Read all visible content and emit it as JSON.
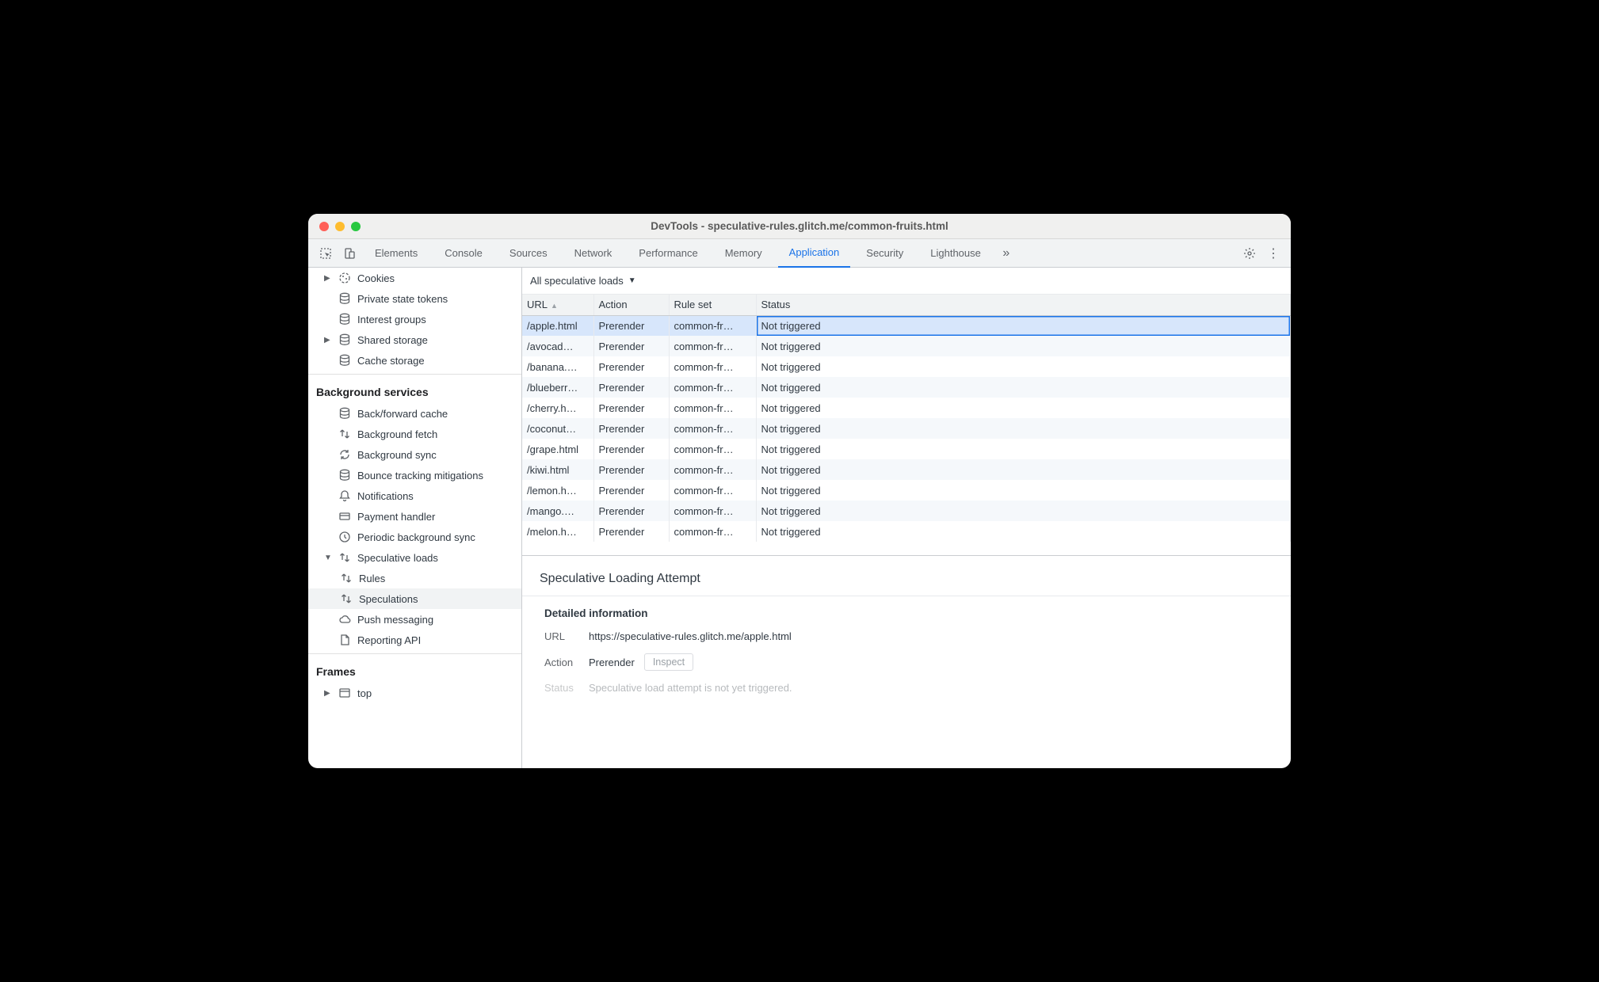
{
  "window": {
    "title": "DevTools - speculative-rules.glitch.me/common-fruits.html"
  },
  "tabs": {
    "items": [
      {
        "label": "Elements"
      },
      {
        "label": "Console"
      },
      {
        "label": "Sources"
      },
      {
        "label": "Network"
      },
      {
        "label": "Performance"
      },
      {
        "label": "Memory"
      },
      {
        "label": "Application",
        "active": true
      },
      {
        "label": "Security"
      },
      {
        "label": "Lighthouse"
      }
    ]
  },
  "sidebar": {
    "storage": [
      {
        "label": "Cookies",
        "icon": "cookie-icon",
        "expandable": true
      },
      {
        "label": "Private state tokens",
        "icon": "database-icon"
      },
      {
        "label": "Interest groups",
        "icon": "database-icon"
      },
      {
        "label": "Shared storage",
        "icon": "database-icon",
        "expandable": true
      },
      {
        "label": "Cache storage",
        "icon": "database-icon"
      }
    ],
    "bg_heading": "Background services",
    "bg": [
      {
        "label": "Back/forward cache",
        "icon": "database-icon"
      },
      {
        "label": "Background fetch",
        "icon": "transfer-icon"
      },
      {
        "label": "Background sync",
        "icon": "sync-icon"
      },
      {
        "label": "Bounce tracking mitigations",
        "icon": "database-icon"
      },
      {
        "label": "Notifications",
        "icon": "bell-icon"
      },
      {
        "label": "Payment handler",
        "icon": "card-icon"
      },
      {
        "label": "Periodic background sync",
        "icon": "clock-icon"
      },
      {
        "label": "Speculative loads",
        "icon": "transfer-icon",
        "expanded": true,
        "expandable": true
      },
      {
        "label": "Rules",
        "icon": "transfer-icon",
        "child": true
      },
      {
        "label": "Speculations",
        "icon": "transfer-icon",
        "child": true,
        "selected": true
      },
      {
        "label": "Push messaging",
        "icon": "cloud-icon"
      },
      {
        "label": "Reporting API",
        "icon": "document-icon"
      }
    ],
    "frames_heading": "Frames",
    "frames": [
      {
        "label": "top",
        "icon": "frame-icon",
        "expandable": true
      }
    ]
  },
  "filter": {
    "label": "All speculative loads"
  },
  "table": {
    "columns": [
      "URL",
      "Action",
      "Rule set",
      "Status"
    ],
    "rows": [
      {
        "url": "/apple.html",
        "action": "Prerender",
        "ruleset": "common-fr…",
        "status": "Not triggered",
        "selected": true
      },
      {
        "url": "/avocad…",
        "action": "Prerender",
        "ruleset": "common-fr…",
        "status": "Not triggered"
      },
      {
        "url": "/banana.…",
        "action": "Prerender",
        "ruleset": "common-fr…",
        "status": "Not triggered"
      },
      {
        "url": "/blueberr…",
        "action": "Prerender",
        "ruleset": "common-fr…",
        "status": "Not triggered"
      },
      {
        "url": "/cherry.h…",
        "action": "Prerender",
        "ruleset": "common-fr…",
        "status": "Not triggered"
      },
      {
        "url": "/coconut…",
        "action": "Prerender",
        "ruleset": "common-fr…",
        "status": "Not triggered"
      },
      {
        "url": "/grape.html",
        "action": "Prerender",
        "ruleset": "common-fr…",
        "status": "Not triggered"
      },
      {
        "url": "/kiwi.html",
        "action": "Prerender",
        "ruleset": "common-fr…",
        "status": "Not triggered"
      },
      {
        "url": "/lemon.h…",
        "action": "Prerender",
        "ruleset": "common-fr…",
        "status": "Not triggered"
      },
      {
        "url": "/mango.…",
        "action": "Prerender",
        "ruleset": "common-fr…",
        "status": "Not triggered"
      },
      {
        "url": "/melon.h…",
        "action": "Prerender",
        "ruleset": "common-fr…",
        "status": "Not triggered"
      }
    ]
  },
  "details": {
    "title": "Speculative Loading Attempt",
    "heading": "Detailed information",
    "url_label": "URL",
    "url_value": "https://speculative-rules.glitch.me/apple.html",
    "action_label": "Action",
    "action_value": "Prerender",
    "inspect_label": "Inspect",
    "status_label": "Status",
    "status_value": "Speculative load attempt is not yet triggered."
  }
}
